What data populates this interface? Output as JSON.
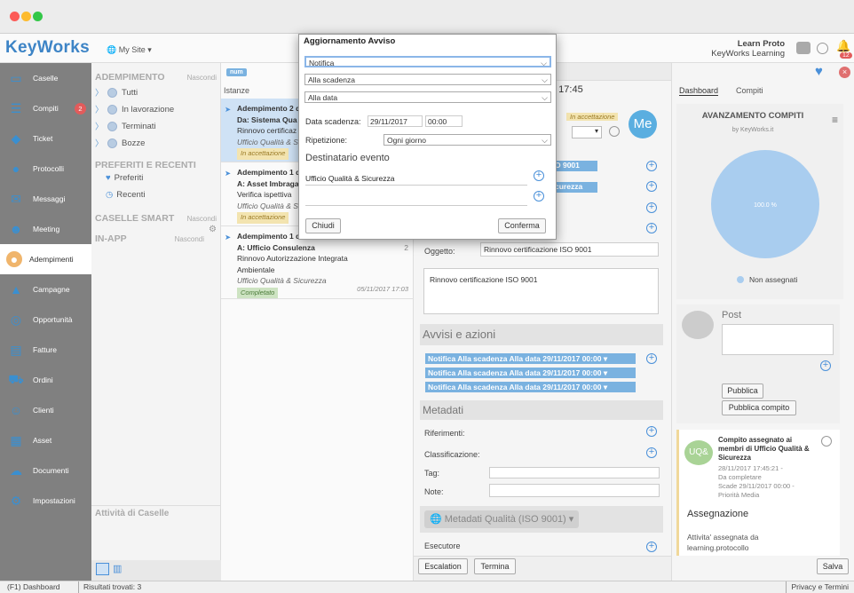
{
  "app": {
    "name": "KeyWorks",
    "site": "My Site",
    "user_name": "Learn Proto",
    "user_org": "KeyWorks Learning",
    "notif_count": "12"
  },
  "sidebar": {
    "items": [
      {
        "label": "Caselle",
        "icon": "inbox-icon"
      },
      {
        "label": "Compiti",
        "icon": "tasks-icon",
        "badge": "2"
      },
      {
        "label": "Ticket",
        "icon": "ticket-icon"
      },
      {
        "label": "Protocolli",
        "icon": "protocol-icon"
      },
      {
        "label": "Messaggi",
        "icon": "mail-icon"
      },
      {
        "label": "Meeting",
        "icon": "people-icon"
      },
      {
        "label": "Adempimenti",
        "icon": "compliance-icon"
      },
      {
        "label": "Campagne",
        "icon": "campaign-icon"
      },
      {
        "label": "Opportunità",
        "icon": "target-icon"
      },
      {
        "label": "Fatture",
        "icon": "invoice-icon"
      },
      {
        "label": "Ordini",
        "icon": "cart-icon"
      },
      {
        "label": "Clienti",
        "icon": "person-icon"
      },
      {
        "label": "Asset",
        "icon": "asset-icon"
      },
      {
        "label": "Documenti",
        "icon": "cloud-icon"
      },
      {
        "label": "Impostazioni",
        "icon": "gear-icon"
      }
    ]
  },
  "col1": {
    "adempimento": "ADEMPIMENTO",
    "hide": "Nascondi",
    "tree": [
      "Tutti",
      "In lavorazione",
      "Terminati",
      "Bozze"
    ],
    "preferiti_title": "PREFERITI E RECENTI",
    "preferiti": "Preferiti",
    "recenti": "Recenti",
    "smart": "CASELLE SMART",
    "inapp": "IN-APP",
    "activity": "Attività di Caselle"
  },
  "col2": {
    "num": "num",
    "header": "Istanze",
    "cards": [
      {
        "l1": "Adempimento 2 d",
        "l2": "Da: Sistema Qua",
        "l3": "Rinnovo certificaz",
        "l4": "Ufficio Qualità & S",
        "tag": "In accettazione"
      },
      {
        "l1": "Adempimento 1 d",
        "l2": "A: Asset Imbraga",
        "l3": "Verifica ispettiva",
        "l4": "Ufficio Qualità & S",
        "tag": "In accettazione"
      },
      {
        "l1": "Adempimento 1 d",
        "l2": "A: Ufficio Consulenza",
        "l3": "Rinnovo Autorizzazione Integrata Ambientale",
        "l4": "Ufficio Qualità & Sicurezza",
        "tag": "Completato",
        "count": "2",
        "date": "05/11/2017 17:03"
      }
    ]
  },
  "col3": {
    "time": "7 17:45",
    "status_tag": "In accettazione",
    "avatar": "Me",
    "pill1": "O 9001",
    "pill2": "curezza",
    "oggetto_label": "Oggetto:",
    "oggetto": "Rinnovo certificazione ISO 9001",
    "descr": "Rinnovo certificazione ISO 9001",
    "avvisi_title": "Avvisi e azioni",
    "avvisi": [
      "Notifica Alla scadenza Alla data 29/11/2017 00:00",
      "Notifica Alla scadenza Alla data 29/11/2017 00:00",
      "Notifica Alla scadenza Alla data 29/11/2017 00:00"
    ],
    "metadati_title": "Metadati",
    "riferimenti": "Riferimenti:",
    "classificazione": "Classificazione:",
    "tag": "Tag:",
    "note": "Note:",
    "qualita": "Metadati Qualità (ISO 9001)",
    "esecutore": "Esecutore",
    "escalation": "Escalation",
    "termina": "Termina"
  },
  "col4": {
    "tabs": [
      "Dashboard",
      "Compiti"
    ],
    "chart_title": "AVANZAMENTO COMPITI",
    "chart_sub": "by KeyWorks.it",
    "legend": "Non assegnati",
    "post_title": "Post",
    "pubblica": "Pubblica",
    "pubblica_compito": "Pubblica compito",
    "task_avatar": "UQ&",
    "task_title": "Compito assegnato ai membri di Ufficio Qualità & Sicurezza",
    "task_date": "28/11/2017 17:45:21 -",
    "task_state": "Da completare",
    "task_due": "Scade 29/11/2017 00:00 -",
    "task_prio": "Priorità Media",
    "assegnazione": "Assegnazione",
    "assegnazione_text": "Attivita' assegnata da learning.protocollo",
    "salva": "Salva"
  },
  "chart_data": {
    "type": "pie",
    "title": "AVANZAMENTO COMPITI",
    "subtitle": "by KeyWorks.it",
    "values": [
      100
    ],
    "labels": [
      "100.0 %"
    ],
    "series": [
      {
        "name": "Non assegnati",
        "values": [
          100
        ]
      }
    ],
    "colors": [
      "#a9cdef"
    ]
  },
  "modal": {
    "title": "Aggiornamento Avviso",
    "select1": "Notifica",
    "select2": "Alla scadenza",
    "select3": "Alla data",
    "data_label": "Data scadenza:",
    "date": "29/11/2017",
    "time": "00:00",
    "rep_label": "Ripetizione:",
    "rep_value": "Ogni giorno",
    "dest_title": "Destinatario evento",
    "dest1": "Ufficio Qualità & Sicurezza",
    "close": "Chiudi",
    "confirm": "Conferma"
  },
  "statusbar": {
    "dashboard": "(F1) Dashboard",
    "results": "Risultati trovati: 3",
    "privacy": "Privacy e Termini"
  }
}
